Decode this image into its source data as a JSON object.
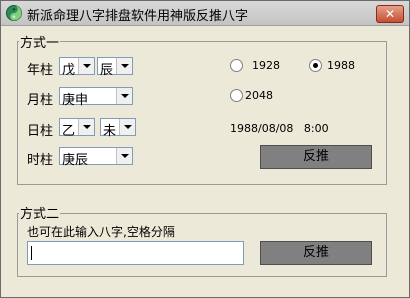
{
  "window": {
    "title": "新派命理八字排盘软件用神版反推八字",
    "close_label": "✕"
  },
  "method1": {
    "group_label": "方式一",
    "year": {
      "label": "年柱",
      "stem": "戊",
      "branch": "辰"
    },
    "month": {
      "label": "月柱",
      "value": "庚申"
    },
    "day": {
      "label": "日柱",
      "stem": "乙",
      "branch": "未"
    },
    "hour": {
      "label": "时柱",
      "value": "庚辰"
    },
    "radios": [
      {
        "label": "1928",
        "checked": false
      },
      {
        "label": "1988",
        "checked": true
      },
      {
        "label": "2048",
        "checked": false
      }
    ],
    "result": "1988/08/08   8:00",
    "button_label": "反推"
  },
  "method2": {
    "group_label": "方式二",
    "instruction": "也可在此输入八字,空格分隔",
    "input_value": "",
    "button_label": "反推"
  }
}
